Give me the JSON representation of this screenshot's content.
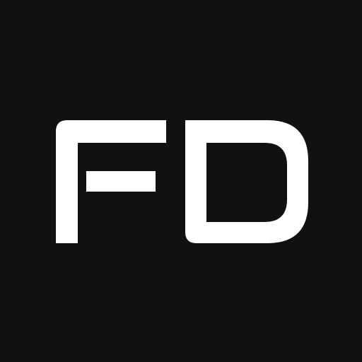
{
  "logo": {
    "text": "FD",
    "background_color": "#111111",
    "foreground_color": "#FFFFFF"
  }
}
